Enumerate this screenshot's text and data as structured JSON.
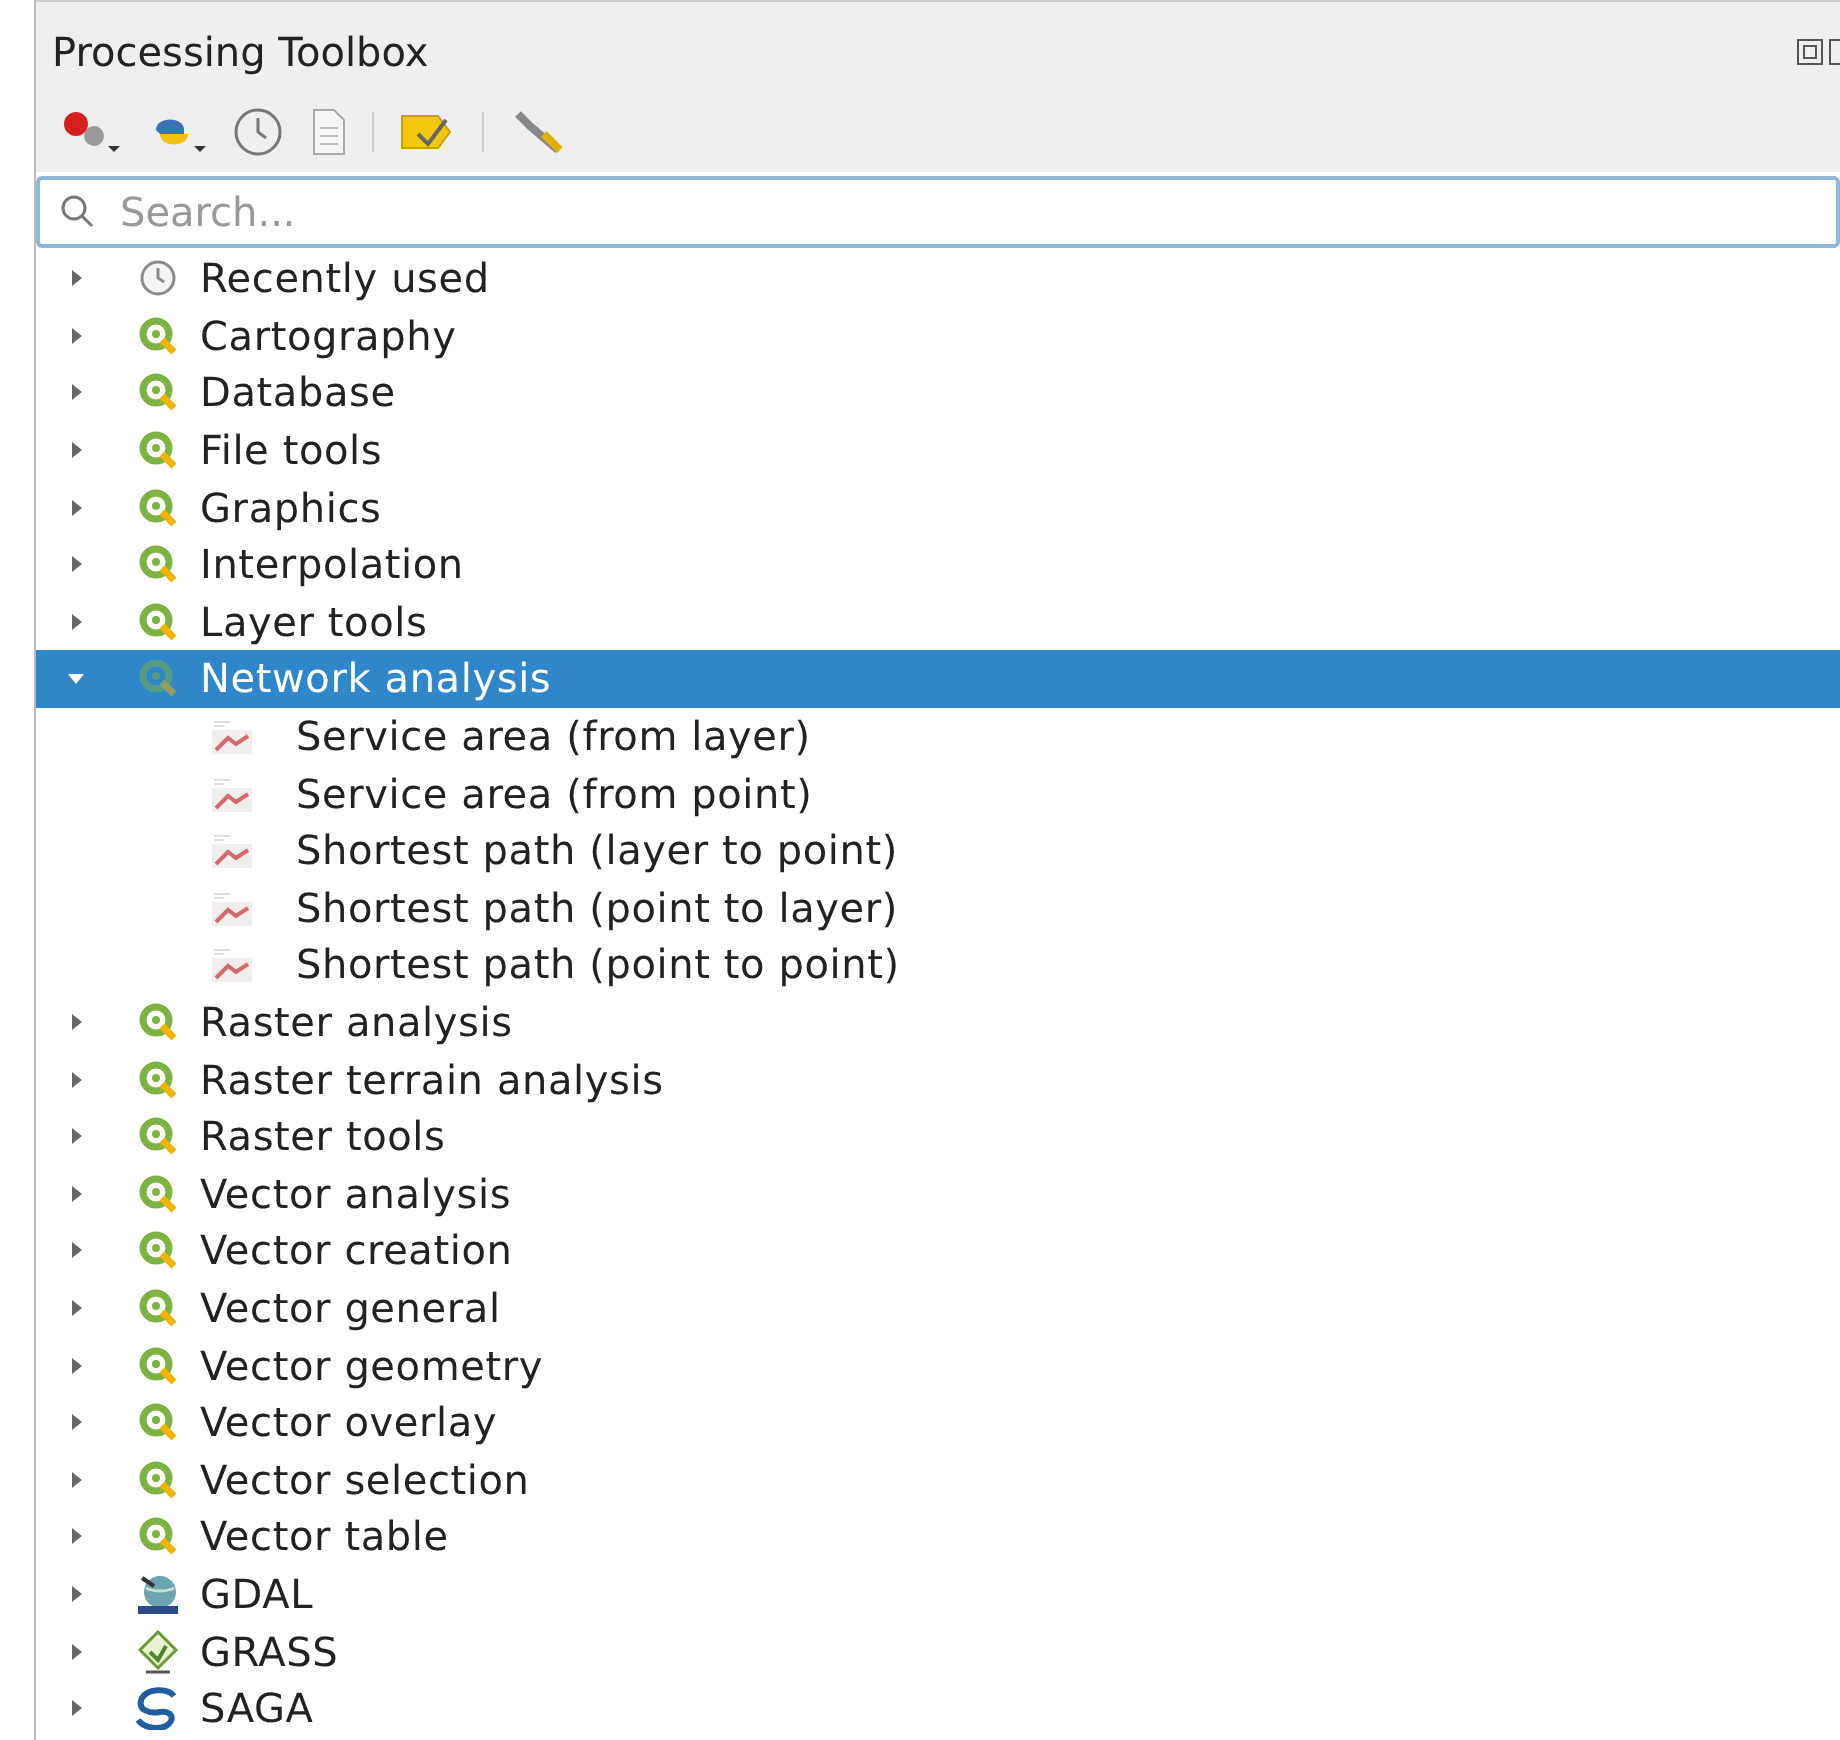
{
  "panel": {
    "title": "Processing Toolbox"
  },
  "search": {
    "placeholder": "Search..."
  },
  "tree": [
    {
      "label": "Recently used",
      "kind": "recent",
      "expanded": false,
      "selected": false
    },
    {
      "label": "Cartography",
      "kind": "qgis",
      "expanded": false,
      "selected": false
    },
    {
      "label": "Database",
      "kind": "qgis",
      "expanded": false,
      "selected": false
    },
    {
      "label": "File tools",
      "kind": "qgis",
      "expanded": false,
      "selected": false
    },
    {
      "label": "Graphics",
      "kind": "qgis",
      "expanded": false,
      "selected": false
    },
    {
      "label": "Interpolation",
      "kind": "qgis",
      "expanded": false,
      "selected": false
    },
    {
      "label": "Layer tools",
      "kind": "qgis",
      "expanded": false,
      "selected": false
    },
    {
      "label": "Network analysis",
      "kind": "qgis",
      "expanded": true,
      "selected": true,
      "children": [
        {
          "label": "Service area (from layer)",
          "kind": "algorithm",
          "selected": false
        },
        {
          "label": "Service area (from point)",
          "kind": "algorithm",
          "selected": false
        },
        {
          "label": "Shortest path (layer to point)",
          "kind": "algorithm",
          "selected": false
        },
        {
          "label": "Shortest path (point to layer)",
          "kind": "algorithm",
          "selected": false
        },
        {
          "label": "Shortest path (point to point)",
          "kind": "algorithm",
          "selected": false
        }
      ]
    },
    {
      "label": "Raster analysis",
      "kind": "qgis",
      "expanded": false,
      "selected": false
    },
    {
      "label": "Raster terrain analysis",
      "kind": "qgis",
      "expanded": false,
      "selected": false
    },
    {
      "label": "Raster tools",
      "kind": "qgis",
      "expanded": false,
      "selected": false
    },
    {
      "label": "Vector analysis",
      "kind": "qgis",
      "expanded": false,
      "selected": false
    },
    {
      "label": "Vector creation",
      "kind": "qgis",
      "expanded": false,
      "selected": false
    },
    {
      "label": "Vector general",
      "kind": "qgis",
      "expanded": false,
      "selected": false
    },
    {
      "label": "Vector geometry",
      "kind": "qgis",
      "expanded": false,
      "selected": false
    },
    {
      "label": "Vector overlay",
      "kind": "qgis",
      "expanded": false,
      "selected": false
    },
    {
      "label": "Vector selection",
      "kind": "qgis",
      "expanded": false,
      "selected": false
    },
    {
      "label": "Vector table",
      "kind": "qgis",
      "expanded": false,
      "selected": false
    },
    {
      "label": "GDAL",
      "kind": "gdal",
      "expanded": false,
      "selected": false
    },
    {
      "label": "GRASS",
      "kind": "grass",
      "expanded": false,
      "selected": false
    },
    {
      "label": "SAGA",
      "kind": "saga",
      "expanded": false,
      "selected": false
    }
  ]
}
